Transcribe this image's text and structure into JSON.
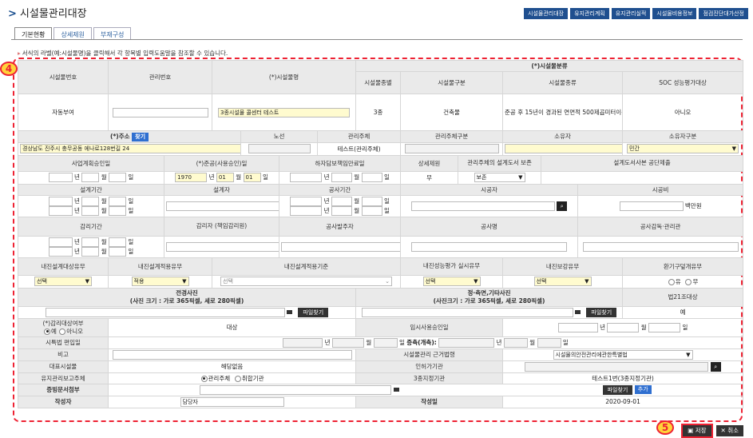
{
  "page": {
    "title": "시설물관리대장",
    "nav": [
      "시설물관리대장",
      "유지관리계획",
      "유지관리실적",
      "시설물비용정보",
      "점검진단대가산정"
    ],
    "tabs": [
      "기본현황",
      "상세제원",
      "부재구성"
    ],
    "hint": "서식의 라벨(예:시설물명)을 클릭해서 각 항목별 입력도움말을 참조할 수 있습니다.",
    "marker4": "4",
    "marker5": "5"
  },
  "row1": {
    "facility_no": "시설물번호",
    "mgmt_no": "관리번호",
    "facility_name": "(*)시설물명",
    "class_group": "(*)시설물분류",
    "grade": "시설물종별",
    "category": "시설물구분",
    "kind": "시설물종류",
    "soc": "SOC 성능평가대상",
    "auto": "자동부여",
    "mgmt_no_val": "",
    "name_val": "3종시설물 콜센터 테스트",
    "grade_val": "3종",
    "category_val": "건축물",
    "kind_val": "준공 후 15년이 경과된 연면적 500제곱미터이상 ~ 1천 제곱미터 미만인 문화 및 집회시설 중 공연장",
    "soc_val": "아니오"
  },
  "row2": {
    "address": "(*)주소",
    "find": "찾기",
    "line": "노선",
    "manager": "관리주체",
    "manager_type": "관리주체구분",
    "owner": "소유자",
    "owner_type": "소유자구분",
    "address_val": "경상남도 진주시 충무공동 에나로128번길 24",
    "manager_val": "테스트(관리주체)",
    "owner_type_val": "민간"
  },
  "row3": {
    "plan_approval": "사업계획승인일",
    "completion": "(*)준공(사용승인)일",
    "warranty_end": "하자담보책임만료일",
    "detail_specs": "상세제원",
    "design_keep": "관리주체의 설계도서 보존",
    "design_submit": "설계도서사본 공단제출",
    "year": "년",
    "month": "월",
    "day": "일",
    "completion_year": "1970",
    "completion_month": "01",
    "completion_day": "01",
    "specs_val": "무",
    "keep_val": "보존"
  },
  "row4": {
    "design_period": "설계기간",
    "designer": "설계자",
    "construction_period": "공사기간",
    "constructor": "시공자",
    "construction_cost": "시공비",
    "cost_unit": "백만원"
  },
  "row5": {
    "supervision_period": "감리기간",
    "supervisor": "감리자 (책임감리원)",
    "client": "공사발주자",
    "construction_name": "공사명",
    "supervising_agency": "공사감독·관리관"
  },
  "row6": {
    "seismic_target": "내진설계대상유무",
    "seismic_applied": "내진설계적용유무",
    "seismic_criteria": "내진설계적용기준",
    "seismic_eval": "내진성능평가 실시유무",
    "seismic_reinforce": "내진보강유무",
    "ventilation": "환기구덮개유무",
    "select": "선택",
    "applied_val": "적용",
    "yes": "유",
    "no": "무"
  },
  "row7": {
    "panorama": "전경사진",
    "panorama_size": "(사진 크기 : 가로 365픽셀, 세로 280픽셀)",
    "side_photo": "정·측면,기타사진",
    "side_size": "(사진크기 : 가로 365픽셀, 세로 280픽셀)",
    "article21": "법21조대상",
    "file_find": "파일찾기",
    "article21_val": "예"
  },
  "row8": {
    "supervision_target": "(*)감리대상여부",
    "yes": "예",
    "no": "아니오",
    "target_val": "대상",
    "temp_use": "임시사용승인일",
    "urban_date": "시특법 편입일",
    "expansion": "증축(개축):",
    "note": "비고",
    "legal_basis": "시설물관리 근거법령",
    "legal_val": "시설물의안전관리에관한특별법",
    "representative": "대표시설물",
    "rep_val": "해당없음",
    "permit_agency": "인허가기관",
    "report_subject": "유지관리보고주체",
    "report_manager": "관리주체",
    "report_union": "취합기관",
    "grade3_agency": "3종지정기관",
    "grade3_val": "테스트1번(3종지정기관)",
    "doc_attach": "증빙문서첨부",
    "add": "추가",
    "writer": "작성자",
    "writer_val": "담당자",
    "write_date": "작성일",
    "write_date_val": "2020-09-01"
  },
  "footer": {
    "save": "저장",
    "cancel": "취소"
  }
}
